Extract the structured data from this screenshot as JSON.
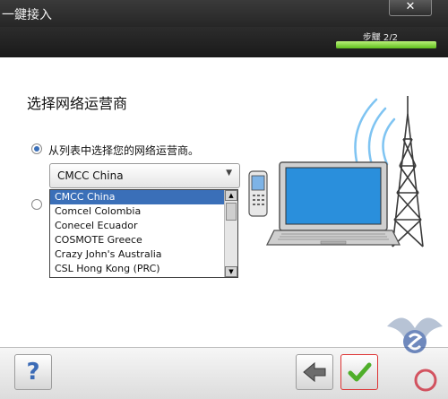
{
  "window": {
    "title": "一鍵接入",
    "close_glyph": "✕"
  },
  "stepper": {
    "label": "步驟 2/2",
    "progress": 1.0,
    "accent": "#5fbf1c"
  },
  "page": {
    "heading": "选择网络运营商"
  },
  "option_from_list": {
    "label": "从列表中选择您的网络运营商。",
    "selected": true
  },
  "carrier_select": {
    "value": "CMCC China"
  },
  "carrier_list": {
    "items": [
      "CMCC China",
      "Comcel Colombia",
      "Conecel Ecuador",
      "COSMOTE Greece",
      "Crazy John's Australia",
      "CSL Hong Kong (PRC)"
    ],
    "selected_index": 0,
    "highlight_color": "#3a6fb8"
  },
  "buttons": {
    "help_label": "?",
    "back_icon": "back-arrow-icon",
    "ok_icon": "checkmark-icon"
  }
}
